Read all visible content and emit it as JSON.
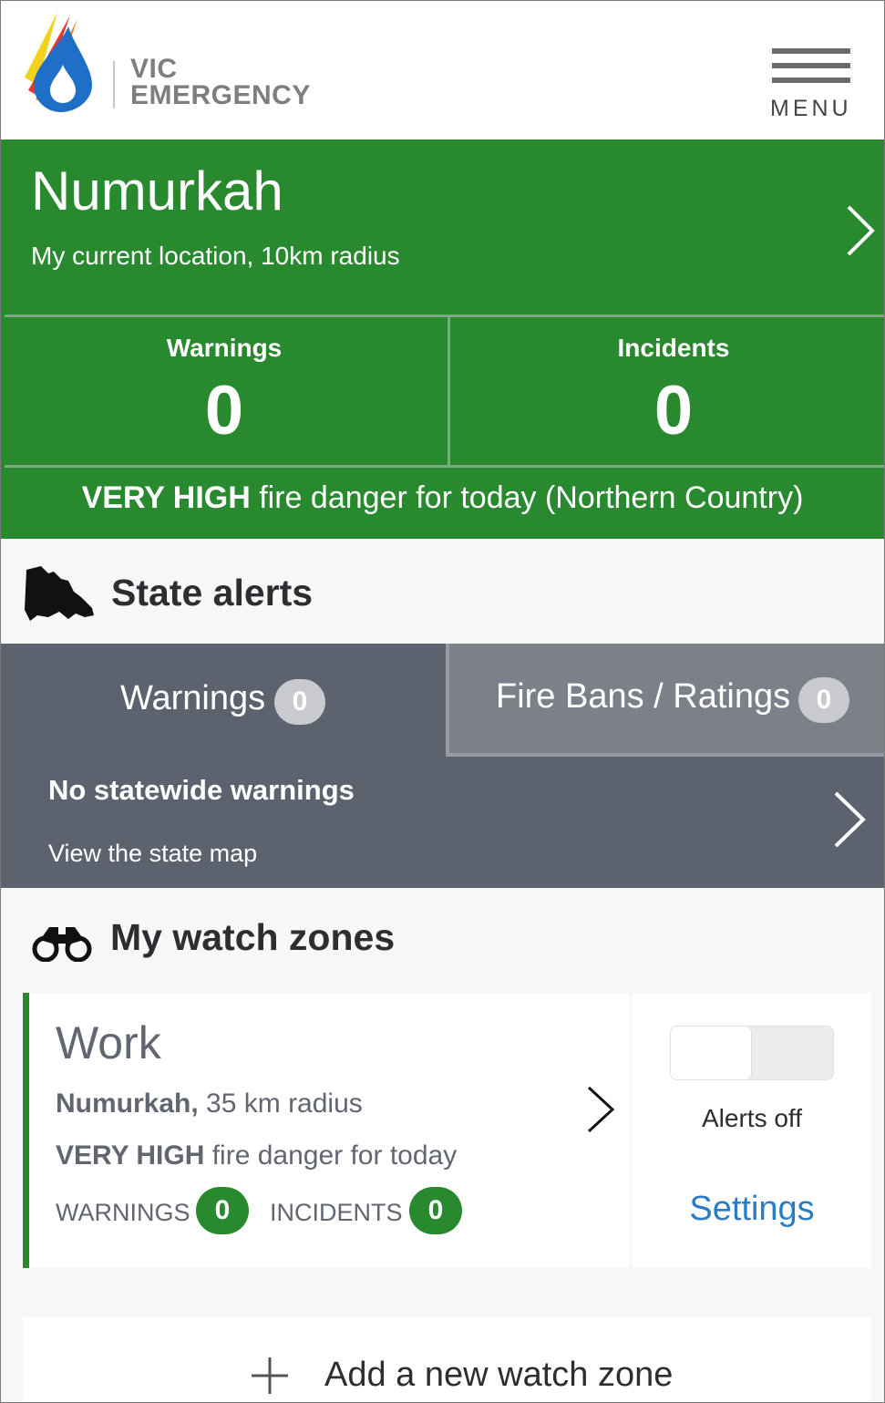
{
  "header": {
    "logo_line1": "VIC",
    "logo_line2": "EMERGENCY",
    "menu_label": "MENU"
  },
  "location": {
    "title": "Numurkah",
    "subtitle": "My current location, 10km radius",
    "warnings_label": "Warnings",
    "warnings_count": "0",
    "incidents_label": "Incidents",
    "incidents_count": "0",
    "danger_level": "VERY HIGH",
    "danger_text": " fire danger for today (Northern Country)"
  },
  "state_alerts": {
    "title": "State alerts",
    "tabs": [
      {
        "label": "Warnings",
        "count": "0"
      },
      {
        "label": "Fire Bans / Ratings",
        "count": "0"
      }
    ],
    "message": "No statewide warnings",
    "link": "View the state map"
  },
  "watch_zones": {
    "title": "My watch zones",
    "zone": {
      "name": "Work",
      "place": "Numurkah,",
      "radius": " 35 km radius",
      "danger_level": "VERY HIGH",
      "danger_text": " fire danger for today",
      "warnings_label": "WARNINGS",
      "warnings_count": "0",
      "incidents_label": "INCIDENTS",
      "incidents_count": "0",
      "alerts_status": "Alerts off",
      "settings_label": "Settings"
    },
    "add_label": "Add a new watch zone"
  },
  "colors": {
    "brand_green": "#28892f",
    "slate": "#5d636e",
    "link_blue": "#2a7dc4"
  }
}
